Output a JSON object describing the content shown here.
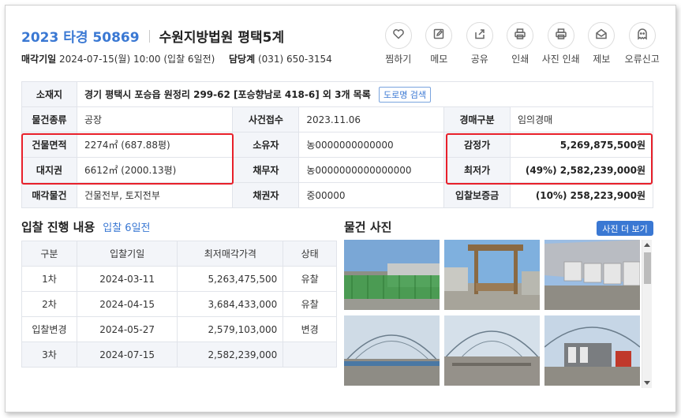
{
  "header": {
    "case_number": "2023 타경 50869",
    "court": "수원지방법원 평택5계",
    "sale_date_label": "매각기일",
    "sale_date": "2024-07-15(월) 10:00 (입찰 6일전)",
    "contact_label": "담당계",
    "contact_phone": "(031) 650-3154"
  },
  "actions": [
    {
      "label": "찜하기",
      "icon": "heart-icon"
    },
    {
      "label": "메모",
      "icon": "memo-edit-icon"
    },
    {
      "label": "공유",
      "icon": "share-icon"
    },
    {
      "label": "인쇄",
      "icon": "print-icon"
    },
    {
      "label": "사진 인쇄",
      "icon": "photo-print-icon"
    },
    {
      "label": "제보",
      "icon": "report-mail-icon"
    },
    {
      "label": "오류신고",
      "icon": "ghost-error-icon"
    }
  ],
  "info": {
    "location_label": "소재지",
    "location_value": "경기 평택시 포승읍 원정리 299-62 [포승향남로 418-6] 외 3개 목록",
    "road_search_label": "도로명 검색",
    "property_type_label": "물건종류",
    "property_type_value": "공장",
    "case_received_label": "사건접수",
    "case_received_value": "2023.11.06",
    "auction_type_label": "경매구분",
    "auction_type_value": "임의경매",
    "building_area_label": "건물면적",
    "building_area_value": "2274㎡ (687.88평)",
    "owner_label": "소유자",
    "owner_value": "농0000000000000",
    "appraisal_label": "감정가",
    "appraisal_value": "5,269,875,500원",
    "land_right_label": "대지권",
    "land_right_value": "6612㎡ (2000.13평)",
    "debtor_label": "채무자",
    "debtor_value": "농0000000000000000",
    "min_price_label": "최저가",
    "min_price_value": "(49%) 2,582,239,000원",
    "sale_item_label": "매각물건",
    "sale_item_value": "건물전부, 토지전부",
    "creditor_label": "채권자",
    "creditor_value": "중00000",
    "deposit_label": "입찰보증금",
    "deposit_value": "(10%) 258,223,900원"
  },
  "bids": {
    "title": "입찰 진행 내용",
    "note": "입찰 6일전",
    "headers": [
      "구분",
      "입찰기일",
      "최저매각가격",
      "상태"
    ],
    "rows": [
      {
        "round": "1차",
        "date": "2024-03-11",
        "price": "5,263,475,500",
        "status": "유찰"
      },
      {
        "round": "2차",
        "date": "2024-04-15",
        "price": "3,684,433,000",
        "status": "유찰"
      },
      {
        "round": "입찰변경",
        "date": "2024-05-27",
        "price": "2,579,103,000",
        "status": "변경"
      },
      {
        "round": "3차",
        "date": "2024-07-15",
        "price": "2,582,239,000",
        "status": ""
      }
    ]
  },
  "photos": {
    "title": "물건 사진",
    "more_label": "사진 더 보기"
  },
  "colors": {
    "accent": "#3a78d3",
    "highlight_box": "#e8202a",
    "header_cell_bg": "#f3f5f9"
  }
}
